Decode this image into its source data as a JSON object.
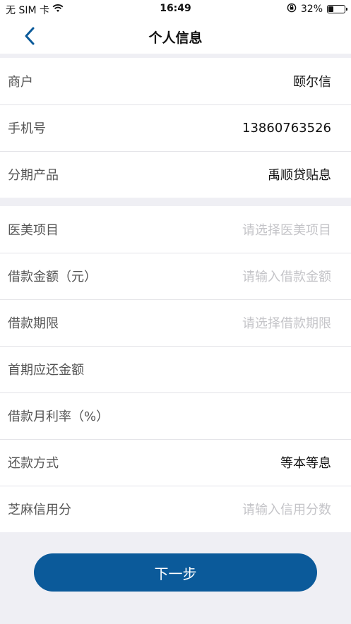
{
  "status_bar": {
    "carrier": "无 SIM 卡",
    "time": "16:49",
    "battery_percent": "32%",
    "battery_level": 0.32,
    "icons": [
      "wifi-icon",
      "rotation-lock-icon",
      "battery-icon"
    ]
  },
  "nav": {
    "title": "个人信息",
    "back_icon": "chevron-left-icon",
    "accent_color": "#0b5a9a"
  },
  "group1": {
    "rows": [
      {
        "label": "商户",
        "value": "颐尔信"
      },
      {
        "label": "手机号",
        "value": "13860763526"
      },
      {
        "label": "分期产品",
        "value": "禹顺贷贴息"
      }
    ]
  },
  "group2": {
    "rows": [
      {
        "label": "医美项目",
        "placeholder": "请选择医美项目"
      },
      {
        "label": "借款金额（元）",
        "placeholder": "请输入借款金额"
      },
      {
        "label": "借款期限",
        "placeholder": "请选择借款期限"
      },
      {
        "label": "首期应还金额",
        "value": ""
      },
      {
        "label": "借款月利率（%）",
        "value": ""
      },
      {
        "label": "还款方式",
        "value": "等本等息"
      },
      {
        "label": "芝麻信用分",
        "placeholder": "请输入信用分数"
      }
    ]
  },
  "footer": {
    "next_label": "下一步"
  }
}
